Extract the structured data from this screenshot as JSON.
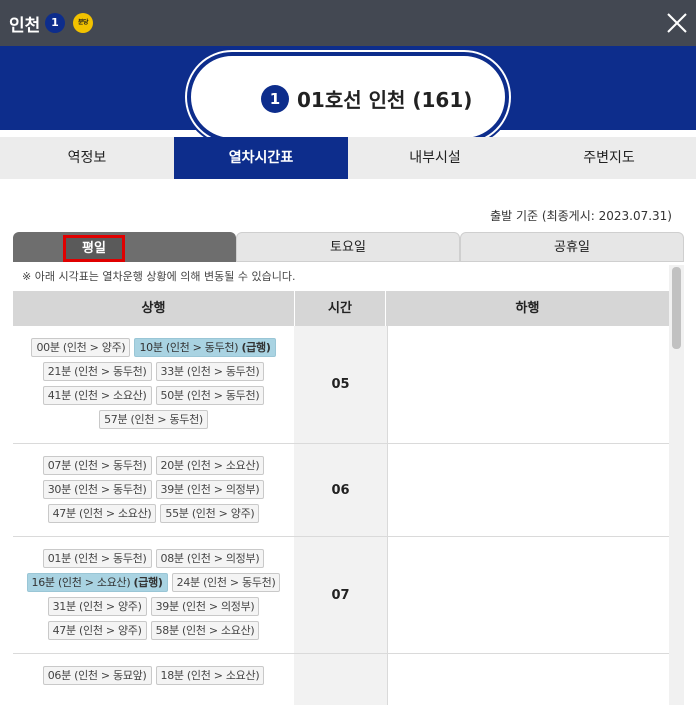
{
  "header": {
    "station": "인천",
    "line_badge": "1",
    "type_badge": "분당",
    "close_icon": "close-icon",
    "colors": {
      "bar": "#434852",
      "brand": "#0d2d8c",
      "badge_yellow": "#f2c200"
    }
  },
  "hero": {
    "line_num": "1",
    "station_label": "01호선 인천 (161)"
  },
  "tabs": [
    {
      "label": "역정보",
      "active": false
    },
    {
      "label": "열차시간표",
      "active": true
    },
    {
      "label": "내부시설",
      "active": false
    },
    {
      "label": "주변지도",
      "active": false
    }
  ],
  "basis": "출발 기준 (최종게시: 2023.07.31)",
  "day_tabs": [
    {
      "label": "평일",
      "active": true
    },
    {
      "label": "토요일",
      "active": false
    },
    {
      "label": "공휴일",
      "active": false
    }
  ],
  "notice": "※ 아래 시각표는 열차운행 상황에 의해 변동될 수 있습니다.",
  "table": {
    "headers": {
      "up": "상행",
      "time": "시간",
      "down": "하행"
    },
    "rows": [
      {
        "hour": "05",
        "up": [
          {
            "text": "00분 (인천 > 양주)",
            "express": false,
            "exp_label": ""
          },
          {
            "text": "10분 (인천 > 동두천)",
            "express": true,
            "exp_label": "(급행)"
          },
          {
            "text": "21분 (인천 > 동두천)",
            "express": false,
            "exp_label": ""
          },
          {
            "text": "33분 (인천 > 동두천)",
            "express": false,
            "exp_label": ""
          },
          {
            "text": "41분 (인천 > 소요산)",
            "express": false,
            "exp_label": ""
          },
          {
            "text": "50분 (인천 > 동두천)",
            "express": false,
            "exp_label": ""
          },
          {
            "text": "57분 (인천 > 동두천)",
            "express": false,
            "exp_label": ""
          }
        ]
      },
      {
        "hour": "06",
        "up": [
          {
            "text": "07분 (인천 > 동두천)",
            "express": false,
            "exp_label": ""
          },
          {
            "text": "20분 (인천 > 소요산)",
            "express": false,
            "exp_label": ""
          },
          {
            "text": "30분 (인천 > 동두천)",
            "express": false,
            "exp_label": ""
          },
          {
            "text": "39분 (인천 > 의정부)",
            "express": false,
            "exp_label": ""
          },
          {
            "text": "47분 (인천 > 소요산)",
            "express": false,
            "exp_label": ""
          },
          {
            "text": "55분 (인천 > 양주)",
            "express": false,
            "exp_label": ""
          }
        ]
      },
      {
        "hour": "07",
        "up": [
          {
            "text": "01분 (인천 > 동두천)",
            "express": false,
            "exp_label": ""
          },
          {
            "text": "08분 (인천 > 의정부)",
            "express": false,
            "exp_label": ""
          },
          {
            "text": "16분 (인천 > 소요산)",
            "express": true,
            "exp_label": "(급행)"
          },
          {
            "text": "24분 (인천 > 동두천)",
            "express": false,
            "exp_label": ""
          },
          {
            "text": "31분 (인천 > 양주)",
            "express": false,
            "exp_label": ""
          },
          {
            "text": "39분 (인천 > 의정부)",
            "express": false,
            "exp_label": ""
          },
          {
            "text": "47분 (인천 > 양주)",
            "express": false,
            "exp_label": ""
          },
          {
            "text": "58분 (인천 > 소요산)",
            "express": false,
            "exp_label": ""
          }
        ]
      },
      {
        "hour": "",
        "up": [
          {
            "text": "06분 (인천 > 동묘앞)",
            "express": false,
            "exp_label": ""
          },
          {
            "text": "18분 (인천 > 소요산)",
            "express": false,
            "exp_label": ""
          }
        ]
      }
    ]
  }
}
